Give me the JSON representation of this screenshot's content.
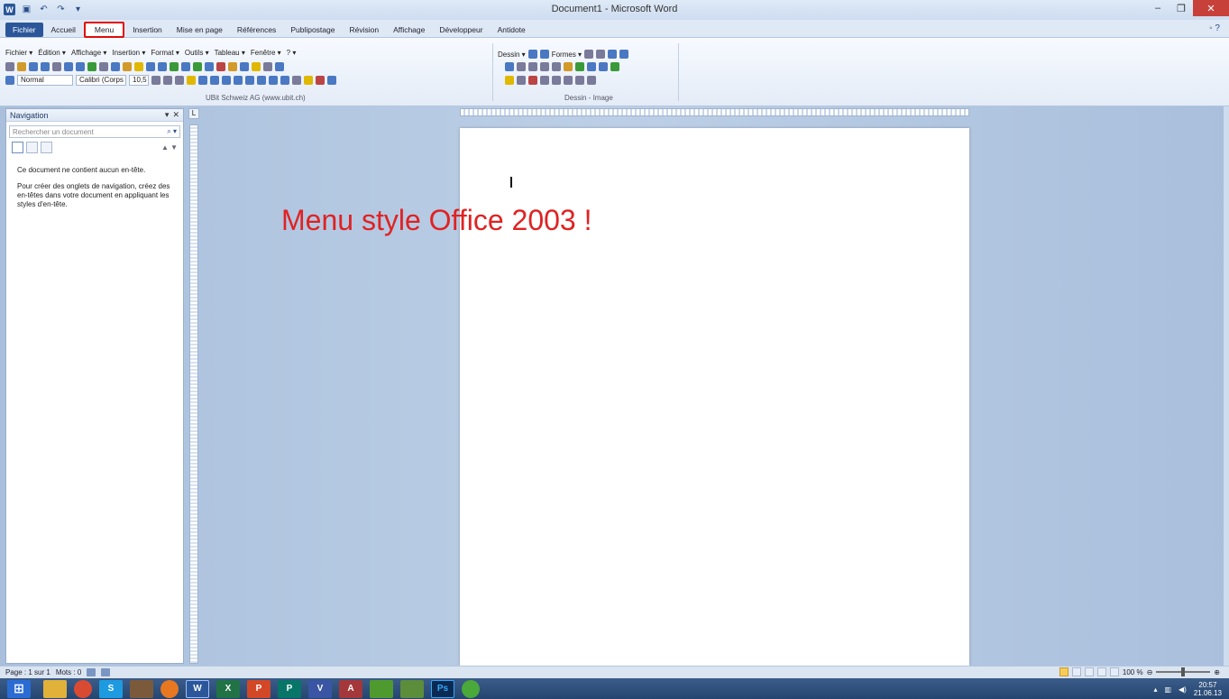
{
  "window": {
    "title": "Document1 - Microsoft Word"
  },
  "tabs": [
    {
      "label": "Fichier"
    },
    {
      "label": "Accueil"
    },
    {
      "label": "Menu"
    },
    {
      "label": "Insertion"
    },
    {
      "label": "Mise en page"
    },
    {
      "label": "Références"
    },
    {
      "label": "Publipostage"
    },
    {
      "label": "Révision"
    },
    {
      "label": "Affichage"
    },
    {
      "label": "Développeur"
    },
    {
      "label": "Antidote"
    }
  ],
  "menubar": [
    "Fichier ▾",
    "Édition ▾",
    "Affichage ▾",
    "Insertion ▾",
    "Format ▾",
    "Outils ▾",
    "Tableau ▾",
    "Fenêtre ▾",
    "? ▾"
  ],
  "ribbon": {
    "style_value": "Normal",
    "font_value": "Calibri (Corps",
    "size_value": "10,5",
    "group_label_left": "UBit Schweiz AG (www.ubit.ch)",
    "drawing_menu": "Dessin ▾",
    "shapes_menu": "Formes ▾",
    "group_label_right": "Dessin - Image"
  },
  "navigation": {
    "title": "Navigation",
    "search_placeholder": "Rechercher un document",
    "message_1": "Ce document ne contient aucun en-tête.",
    "message_2": "Pour créer des onglets de navigation, créez des en-têtes dans votre document en appliquant les styles d'en-tête."
  },
  "overlay": {
    "text": "Menu style Office 2003 !"
  },
  "statusbar": {
    "page": "Page : 1 sur 1",
    "words": "Mots : 0",
    "zoom": "100 %"
  },
  "taskbar": {
    "apps": [
      {
        "icon": "start-icon",
        "color": "#2b6cd4"
      },
      {
        "icon": "file-explorer-icon",
        "color": "#e0b23a"
      },
      {
        "icon": "chrome-icon",
        "color": "#d94a33"
      },
      {
        "icon": "skype-icon",
        "color": "#1e9be0",
        "label": "S"
      },
      {
        "icon": "app-icon",
        "color": "#7a5a3a"
      },
      {
        "icon": "player-icon",
        "color": "#e87722"
      },
      {
        "icon": "word-icon",
        "color": "#2b579a",
        "label": "W"
      },
      {
        "icon": "excel-icon",
        "color": "#217346",
        "label": "X"
      },
      {
        "icon": "powerpoint-icon",
        "color": "#d24726",
        "label": "P"
      },
      {
        "icon": "publisher-icon",
        "color": "#077568",
        "label": "P"
      },
      {
        "icon": "visio-icon",
        "color": "#3955a3",
        "label": "V"
      },
      {
        "icon": "access-icon",
        "color": "#a4373a",
        "label": "A"
      },
      {
        "icon": "image-app-icon",
        "color": "#4f9a2f"
      },
      {
        "icon": "notepad-icon",
        "color": "#5c8d3a"
      },
      {
        "icon": "photoshop-icon",
        "color": "#0b2a52",
        "label": "Ps"
      },
      {
        "icon": "utorrent-icon",
        "color": "#4ba83a"
      }
    ],
    "time": "20:57",
    "date": "21.06.13"
  }
}
